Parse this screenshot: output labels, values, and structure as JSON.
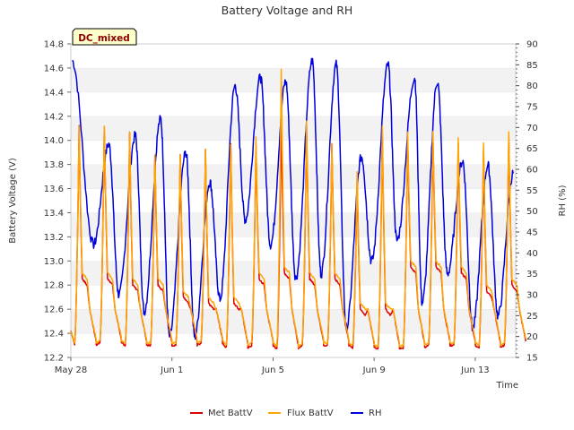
{
  "chart_data": {
    "type": "line",
    "title": "Battery Voltage and RH",
    "badge": "DC_mixed",
    "xlabel": "Time",
    "ylabel": "Battery Voltage (V)",
    "y2label": "RH (%)",
    "x_ticks": [
      "May 28",
      "Jun 1",
      "Jun 5",
      "Jun 9",
      "Jun 13"
    ],
    "x_start": "May 28",
    "xlim_days": [
      0,
      17.6
    ],
    "ylim": [
      12.2,
      14.8
    ],
    "y_ticks": [
      "12.2",
      "12.4",
      "12.6",
      "12.8",
      "13.0",
      "13.2",
      "13.4",
      "13.6",
      "13.8",
      "14.0",
      "14.2",
      "14.4",
      "14.6",
      "14.8"
    ],
    "y2lim": [
      15,
      90
    ],
    "y2_ticks": [
      "15",
      "20",
      "25",
      "30",
      "35",
      "40",
      "45",
      "50",
      "55",
      "60",
      "65",
      "70",
      "75",
      "80",
      "85",
      "90"
    ],
    "grid": "horizontal bands",
    "legend_position": "bottom",
    "colors": {
      "met": "#dd0000",
      "flux": "#ffa500",
      "rh": "#0000dd"
    },
    "series": [
      {
        "name": "Met BattV",
        "axis": "left",
        "note": "daily charge peaks (data units: days since May 28, volts)",
        "x": [
          0.35,
          1.35,
          2.35,
          3.35,
          4.35,
          5.35,
          6.35,
          7.35,
          8.35,
          9.35,
          10.35,
          11.35,
          12.35,
          13.35,
          14.35,
          15.35,
          16.35,
          17.35
        ],
        "peaks": [
          14.2,
          14.2,
          14.15,
          13.95,
          13.95,
          14.0,
          14.05,
          14.05,
          14.25,
          14.2,
          14.05,
          13.75,
          14.15,
          14.1,
          14.1,
          14.05,
          14.0,
          14.1
        ],
        "troughs": [
          12.3,
          12.32,
          12.3,
          12.3,
          12.3,
          12.32,
          12.28,
          12.3,
          12.27,
          12.3,
          12.3,
          12.28,
          12.27,
          12.28,
          12.3,
          12.3,
          12.28,
          12.3
        ],
        "plateaus": [
          12.85,
          12.85,
          12.8,
          12.8,
          12.7,
          12.65,
          12.65,
          12.85,
          12.9,
          12.85,
          12.85,
          12.6,
          12.6,
          12.95,
          12.95,
          12.9,
          12.75,
          12.8
        ]
      },
      {
        "name": "Flux BattV",
        "axis": "left",
        "x": [
          0.35,
          1.35,
          2.35,
          3.35,
          4.35,
          5.35,
          6.35,
          7.35,
          8.35,
          9.35,
          10.35,
          11.35,
          12.35,
          13.35,
          14.35,
          15.35,
          16.35,
          17.35
        ],
        "peaks": [
          14.2,
          14.2,
          14.15,
          13.95,
          13.95,
          14.0,
          14.05,
          14.1,
          14.7,
          14.25,
          14.05,
          13.8,
          14.2,
          14.15,
          14.15,
          14.1,
          14.05,
          14.15
        ],
        "troughs": [
          12.32,
          12.34,
          12.32,
          12.32,
          12.32,
          12.34,
          12.3,
          12.32,
          12.29,
          12.32,
          12.32,
          12.3,
          12.29,
          12.3,
          12.32,
          12.32,
          12.3,
          12.32
        ],
        "plateaus": [
          12.9,
          12.9,
          12.85,
          12.85,
          12.75,
          12.7,
          12.7,
          12.9,
          12.95,
          12.9,
          12.9,
          12.65,
          12.65,
          13.0,
          13.0,
          12.95,
          12.8,
          12.85
        ]
      },
      {
        "name": "RH",
        "axis": "right",
        "note": "daily RH maxima/minima (data units: days since May 28, %RH)",
        "x_max": [
          0.05,
          1.5,
          2.55,
          3.55,
          4.55,
          5.5,
          6.5,
          7.5,
          8.5,
          9.55,
          10.5,
          11.5,
          12.55,
          13.6,
          14.5,
          15.5,
          16.5,
          17.5
        ],
        "max": [
          86,
          66,
          68,
          72,
          64,
          57,
          80,
          82,
          81,
          86,
          85,
          63,
          85,
          82,
          81,
          62,
          61,
          59
        ],
        "x_min": [
          0.9,
          1.9,
          2.9,
          3.9,
          4.9,
          5.9,
          6.9,
          7.9,
          8.9,
          9.9,
          10.9,
          11.9,
          12.9,
          13.9,
          14.9,
          15.9,
          16.9
        ],
        "min": [
          42,
          30,
          26,
          20,
          20,
          29,
          48,
          42,
          34,
          35,
          22,
          38,
          43,
          28,
          35,
          22,
          25
        ]
      }
    ]
  }
}
